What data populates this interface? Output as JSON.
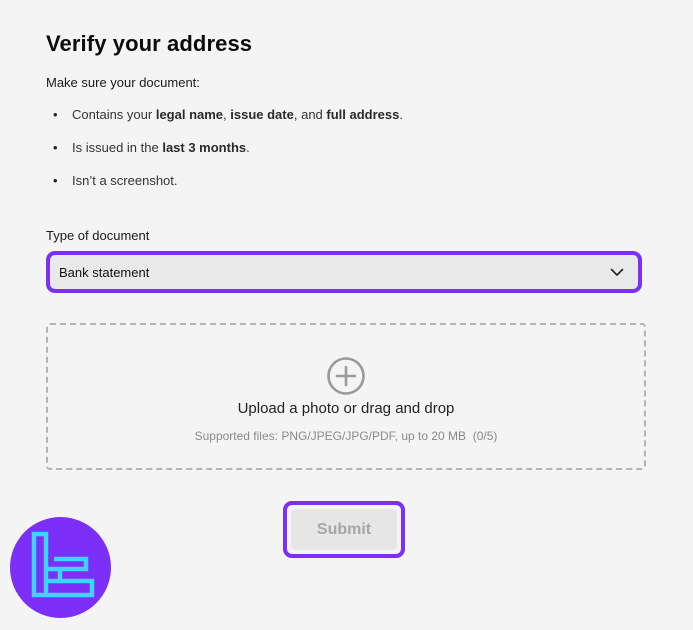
{
  "page": {
    "title": "Verify your address",
    "intro": "Make sure your document:"
  },
  "requirements": [
    {
      "parts": [
        {
          "text": "Contains your ",
          "bold": false
        },
        {
          "text": "legal name",
          "bold": true
        },
        {
          "text": ", ",
          "bold": false
        },
        {
          "text": "issue date",
          "bold": true
        },
        {
          "text": ", and ",
          "bold": false
        },
        {
          "text": "full address",
          "bold": true
        },
        {
          "text": ".",
          "bold": false
        }
      ]
    },
    {
      "parts": [
        {
          "text": "Is issued in the ",
          "bold": false
        },
        {
          "text": "last 3 months",
          "bold": true
        },
        {
          "text": ".",
          "bold": false
        }
      ]
    },
    {
      "parts": [
        {
          "text": "Isn’t a screenshot.",
          "bold": false
        }
      ]
    }
  ],
  "document_type": {
    "label": "Type of document",
    "selected": "Bank statement",
    "chevron_icon": "chevron-down-icon"
  },
  "upload": {
    "icon": "plus-circle-icon",
    "title": "Upload a photo or drag and drop",
    "hint": "Supported files: PNG/JPEG/JPG/PDF, up to 20 MB  (0/5)"
  },
  "submit": {
    "label": "Submit",
    "disabled": true
  },
  "colors": {
    "accent": "#7b2ff7",
    "background": "#f4f4f4",
    "logo_cyan": "#3fd4ff"
  }
}
